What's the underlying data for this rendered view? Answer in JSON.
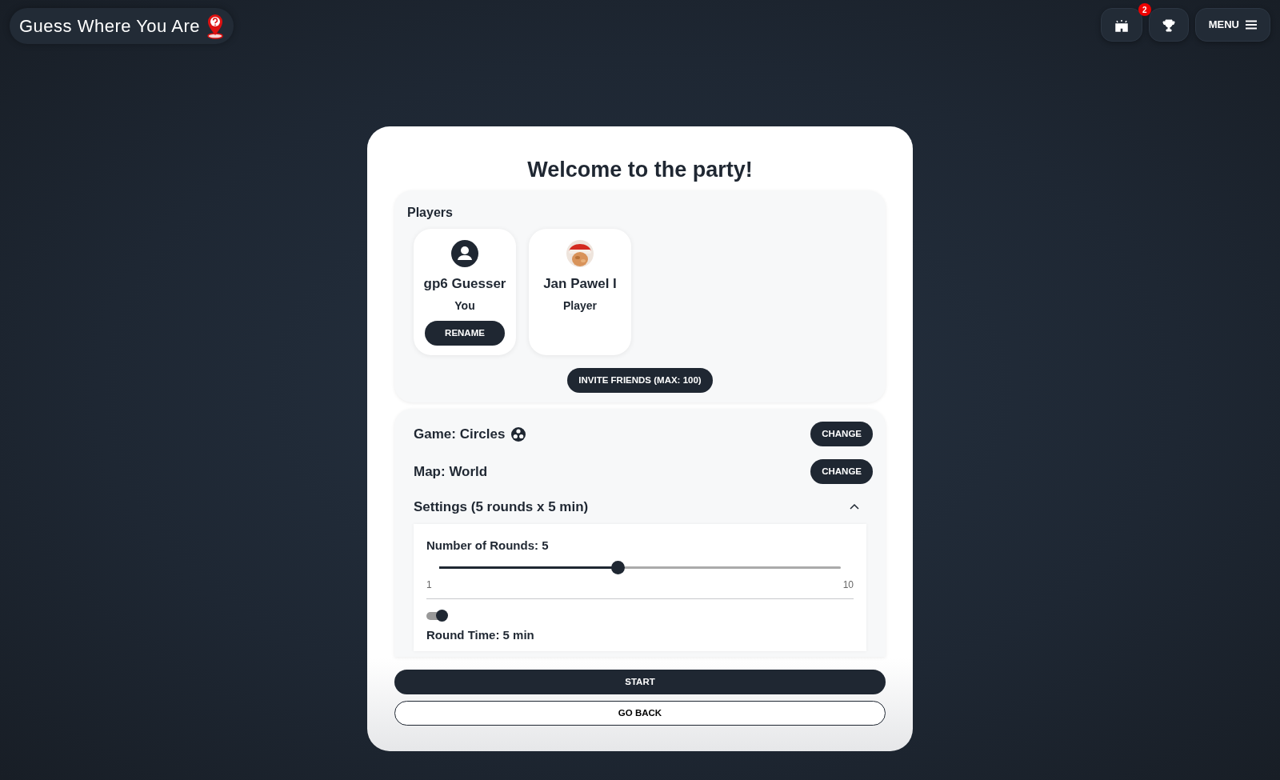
{
  "header": {
    "logo": "Guess Where You Are",
    "notification_count": "2",
    "menu_label": "MENU"
  },
  "card": {
    "title": "Welcome to the party!",
    "players_title": "Players",
    "players": [
      {
        "name": "gp6 Guesser",
        "role": "You",
        "kind": "icon",
        "action": "RENAME"
      },
      {
        "name": "Jan Pawel I",
        "role": "Player",
        "kind": "picture"
      }
    ],
    "invite_button": "INVITE FRIENDS (MAX: 100)",
    "options": [
      {
        "label": "Game: Circles",
        "button": "CHANGE",
        "has_icon": true
      },
      {
        "label": "Map: World",
        "button": "CHANGE",
        "has_icon": false
      }
    ],
    "settings": {
      "title": "Settings (5 rounds x 5 min)",
      "expanded": true,
      "rounds_label": "Number of Rounds: 5",
      "level": 0.444,
      "min": "1",
      "max": "10",
      "timer_on": true,
      "time_label": "Round Time: 5 min"
    },
    "start_button": "START",
    "back_button": "GO BACK"
  }
}
